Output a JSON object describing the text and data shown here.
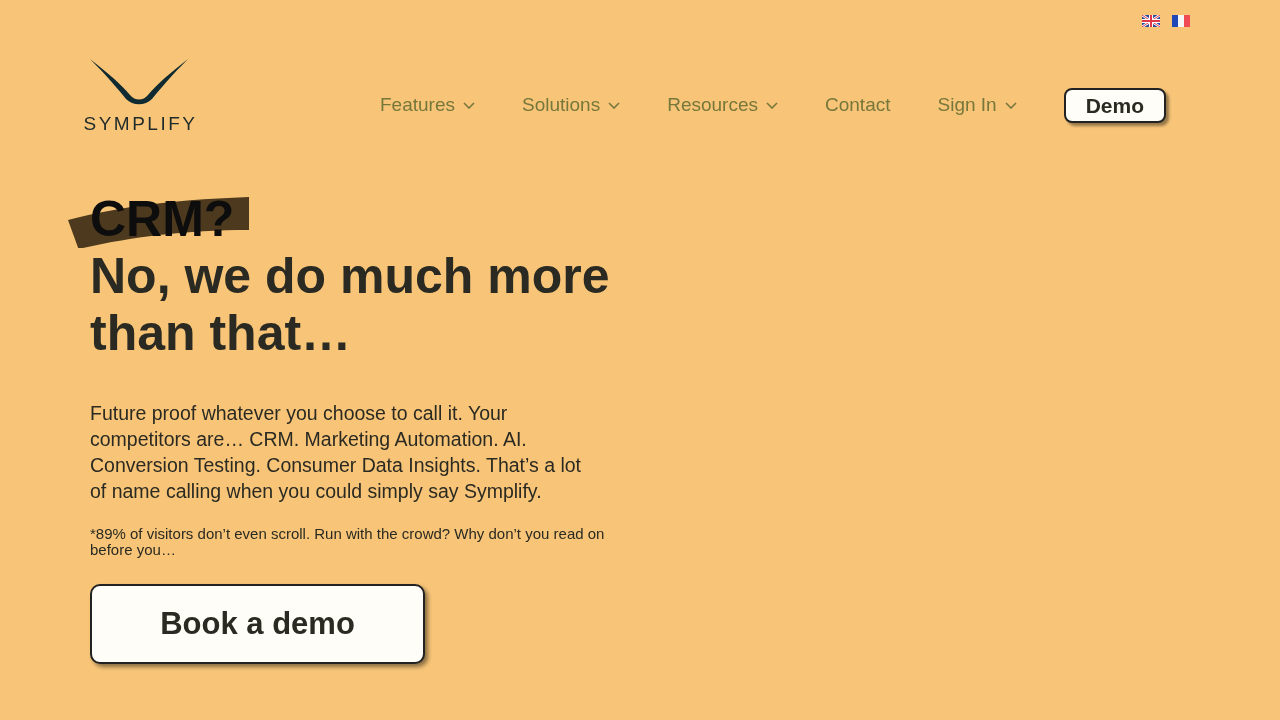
{
  "logo": {
    "wordmark": "SYMPLIFY"
  },
  "nav": {
    "items": [
      {
        "label": "Features",
        "dropdown": true
      },
      {
        "label": "Solutions",
        "dropdown": true
      },
      {
        "label": "Resources",
        "dropdown": true
      },
      {
        "label": "Contact",
        "dropdown": false
      },
      {
        "label": "Sign In",
        "dropdown": true
      }
    ],
    "cta": "Demo"
  },
  "hero": {
    "highlight": "CRM?",
    "headline": "No, we do much more than that…",
    "body": "Future proof whatever you choose to call it. Your competitors are… CRM. Marketing Automation. AI. Conversion Testing. Consumer Data Insights. That’s a lot of name calling when you could simply say Symplify.",
    "footnote": "*89% of visitors don’t even scroll. Run with the crowd? Why don’t you read on before you…",
    "button": "Book a demo"
  }
}
